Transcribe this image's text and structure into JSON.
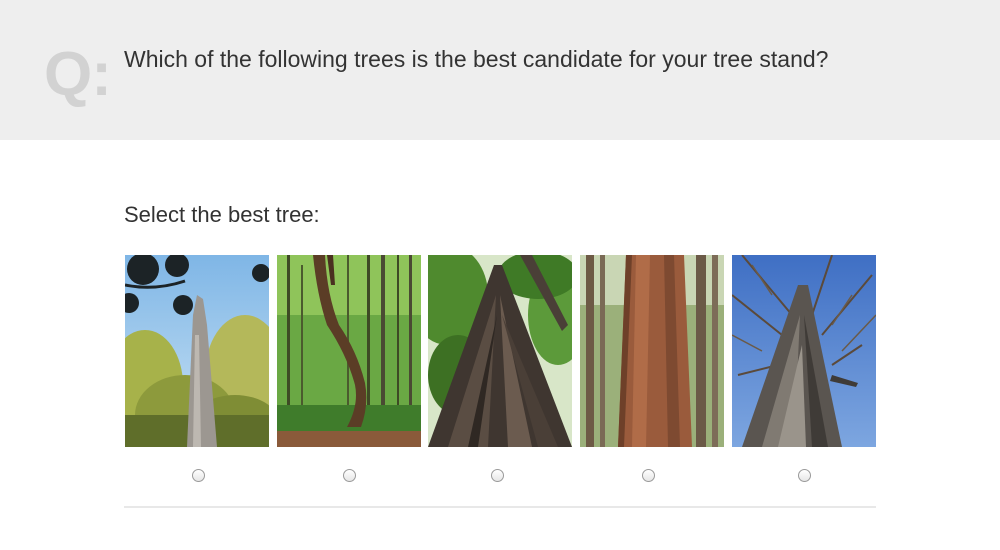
{
  "header": {
    "q_marker": "Q:",
    "question": "Which of the following trees is the best candidate for your tree stand?"
  },
  "prompt": "Select the best tree:",
  "choices": [
    {
      "photo": "dead-snag-tree-photo",
      "selected": false
    },
    {
      "photo": "curved-trunk-tree-photo",
      "selected": false
    },
    {
      "photo": "root-buttressed-tree-photo",
      "selected": false
    },
    {
      "photo": "straight-pine-trunk-photo",
      "selected": false
    },
    {
      "photo": "shaggy-bark-tree-photo",
      "selected": false
    }
  ]
}
